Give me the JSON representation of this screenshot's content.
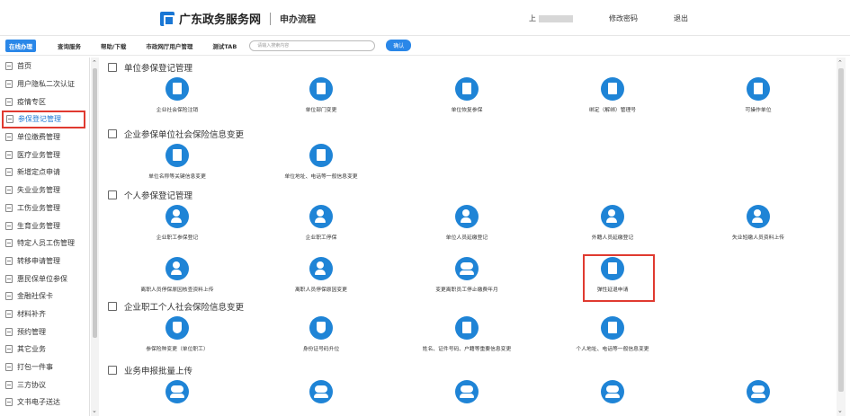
{
  "header": {
    "site_name": "广东政务服务网",
    "subtitle": "申办流程",
    "user_label": "上",
    "change_password": "修改密码",
    "logout": "退出"
  },
  "nav": {
    "items": [
      "在线办理",
      "查询服务",
      "帮助/下载",
      "市政网厅用户管理",
      "测试TAB"
    ],
    "search_placeholder": "请输入搜索内容",
    "confirm_label": "确认"
  },
  "sidebar": {
    "items": [
      {
        "label": "首页",
        "icon": "home-icon"
      },
      {
        "label": "用户隐私二次认证",
        "icon": "doc-icon"
      },
      {
        "label": "疫情专区",
        "icon": "doc-icon"
      },
      {
        "label": "参保登记管理",
        "icon": "doc-icon",
        "active": true
      },
      {
        "label": "单位缴费管理",
        "icon": "doc-icon"
      },
      {
        "label": "医疗业务管理",
        "icon": "doc-icon"
      },
      {
        "label": "新增定点申请",
        "icon": "doc-icon"
      },
      {
        "label": "失业业务管理",
        "icon": "doc-icon"
      },
      {
        "label": "工伤业务管理",
        "icon": "doc-icon"
      },
      {
        "label": "生育业务管理",
        "icon": "doc-icon"
      },
      {
        "label": "特定人员工伤管理",
        "icon": "doc-icon"
      },
      {
        "label": "转移申请管理",
        "icon": "doc-icon"
      },
      {
        "label": "惠民保单位参保",
        "icon": "doc-icon"
      },
      {
        "label": "金融社保卡",
        "icon": "doc-icon"
      },
      {
        "label": "材料补齐",
        "icon": "doc-icon"
      },
      {
        "label": "预约管理",
        "icon": "doc-icon"
      },
      {
        "label": "其它业务",
        "icon": "doc-icon"
      },
      {
        "label": "打包一件事",
        "icon": "doc-icon"
      },
      {
        "label": "三方协议",
        "icon": "doc-icon"
      },
      {
        "label": "文书电子送达",
        "icon": "doc-icon"
      }
    ]
  },
  "sections": [
    {
      "title": "单位参保登记管理",
      "tiles": [
        {
          "label": "企业社会保险注销",
          "icon": "document-icon"
        },
        {
          "label": "单位部门变更",
          "icon": "document-icon"
        },
        {
          "label": "单位恢复参保",
          "icon": "document-icon"
        },
        {
          "label": "绑定（解绑）管理号",
          "icon": "document-icon"
        },
        {
          "label": "可操作单位",
          "icon": "document-icon"
        }
      ]
    },
    {
      "title": "企业参保单位社会保险信息变更",
      "tiles": [
        {
          "label": "单位名称等关键信息变更",
          "icon": "edit-doc-icon"
        },
        {
          "label": "单位地址、电话等一般信息变更",
          "icon": "edit-doc-icon"
        }
      ]
    },
    {
      "title": "个人参保登记管理",
      "tiles": [
        {
          "label": "企业职工参保登记",
          "icon": "person-add-icon"
        },
        {
          "label": "企业职工停保",
          "icon": "person-add-icon"
        },
        {
          "label": "单位人员延缴登记",
          "icon": "person-add-icon"
        },
        {
          "label": "外籍人员延缴登记",
          "icon": "person-add-icon"
        },
        {
          "label": "失业短缴人员资料上传",
          "icon": "person-add-icon"
        },
        {
          "label": "离职人员停保原因核查资料上传",
          "icon": "person-add-icon"
        },
        {
          "label": "离职人员停保原因变更",
          "icon": "person-add-icon"
        },
        {
          "label": "变更离职员工停止缴费年月",
          "icon": "money-icon"
        },
        {
          "label": "弹性延退申请",
          "icon": "edit-doc-icon"
        }
      ]
    },
    {
      "title": "企业职工个人社会保险信息变更",
      "tiles": [
        {
          "label": "参保险种变更（单位职工）",
          "icon": "shield-icon"
        },
        {
          "label": "身份证号码升位",
          "icon": "shield-icon"
        },
        {
          "label": "姓名、证件号码、户籍等重要信息变更",
          "icon": "id-card-icon"
        },
        {
          "label": "个人地址、电话等一般信息变更",
          "icon": "id-card-icon"
        }
      ]
    },
    {
      "title": "业务申报批量上传",
      "tiles": []
    }
  ]
}
